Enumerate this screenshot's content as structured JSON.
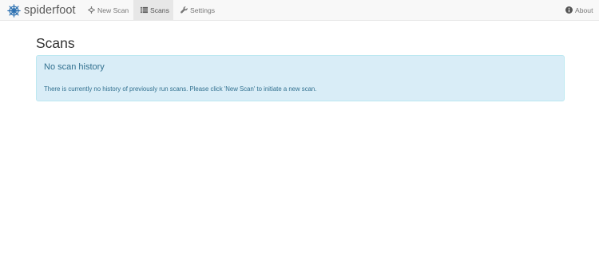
{
  "brand": {
    "name": "spiderfoot",
    "logo_icon": "spider-web-icon"
  },
  "nav": {
    "items": [
      {
        "label": "New Scan",
        "icon": "crosshair-icon",
        "active": false
      },
      {
        "label": "Scans",
        "icon": "list-icon",
        "active": true
      },
      {
        "label": "Settings",
        "icon": "wrench-icon",
        "active": false
      }
    ],
    "about": {
      "label": "About",
      "icon": "info-icon"
    }
  },
  "page": {
    "title": "Scans",
    "alert": {
      "heading": "No scan history",
      "body": "There is currently no history of previously run scans. Please click 'New Scan' to initiate a new scan."
    }
  },
  "colors": {
    "navbar_bg": "#f8f8f8",
    "active_nav_bg": "#e7e7e7",
    "alert_bg": "#d9edf7",
    "alert_border": "#bce8f1",
    "alert_text": "#31708f",
    "brand_blue": "#2a6fb0"
  }
}
